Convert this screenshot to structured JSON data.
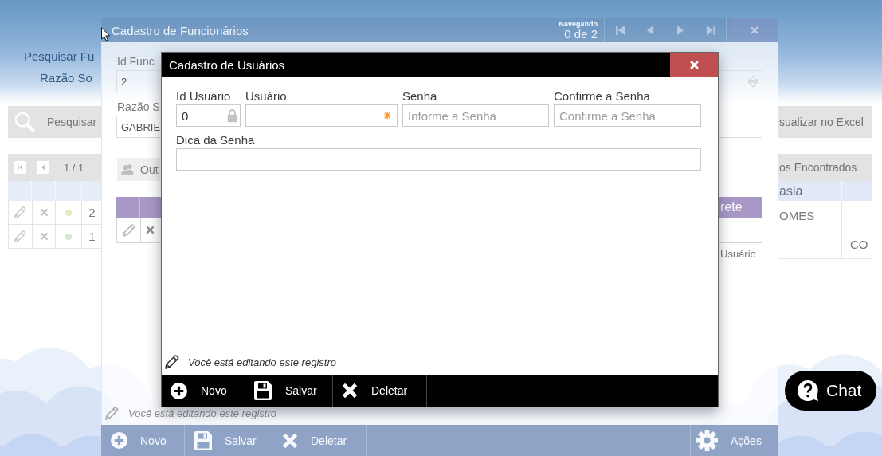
{
  "page": {
    "heading": "Pesquisar Fu",
    "field_label": "Razão So",
    "search_button": {
      "label": "Pesquisar"
    },
    "pager": {
      "page": "1 / 1"
    },
    "table": {
      "rows": [
        {
          "number": "2",
          "color": "#e5ecc4"
        },
        {
          "number": "1",
          "color": "#d0eacd"
        }
      ]
    },
    "excel_button": {
      "label": "sualizar no Excel"
    },
    "results_bar": {
      "label": "os Encontrados"
    },
    "results_table": {
      "columns": [
        "asia"
      ],
      "rows": [
        {
          "column_1": "OMES"
        },
        {
          "column_2": "CO"
        }
      ]
    }
  },
  "employee_window": {
    "title": "Cadastro de Funcionários",
    "navigation": {
      "caption": "Navegando",
      "count": "0 de 2"
    },
    "fields": [
      {
        "label": "Id Func",
        "value": "2",
        "spinner": true
      },
      {
        "label": "Razão S",
        "value": "GABRIE",
        "spinner": false
      }
    ],
    "tab": {
      "label": "Out"
    },
    "table": {
      "columns": [
        "rete"
      ]
    },
    "user_button": {
      "label": "Usuário"
    },
    "status": "Você está editando este registro",
    "toolbar": [
      {
        "kind": "new",
        "label": "Novo"
      },
      {
        "kind": "save",
        "label": "Salvar"
      },
      {
        "kind": "delete",
        "label": "Deletar"
      }
    ],
    "actions_button": {
      "label": "Ações"
    }
  },
  "dialog": {
    "title": "Cadastro de Usuários",
    "rows": [
      [
        {
          "label": "Id Usuário",
          "value": "0",
          "locked": true,
          "required": false
        },
        {
          "label": "Usuário",
          "locked": false,
          "required": true
        },
        {
          "label": "Senha",
          "placeholder": "Informe a Senha",
          "locked": false,
          "required": false
        },
        {
          "label": "Confirme a Senha",
          "placeholder": "Confirme a Senha",
          "locked": false,
          "required": false
        }
      ],
      [
        {
          "label": "Dica da Senha",
          "locked": false,
          "required": false
        }
      ]
    ],
    "status": "Você está editando este registro",
    "toolbar": [
      {
        "kind": "new",
        "label": "Novo"
      },
      {
        "kind": "save",
        "label": "Salvar"
      },
      {
        "kind": "delete",
        "label": "Deletar"
      }
    ]
  },
  "chat_button": {
    "label": "Chat"
  }
}
